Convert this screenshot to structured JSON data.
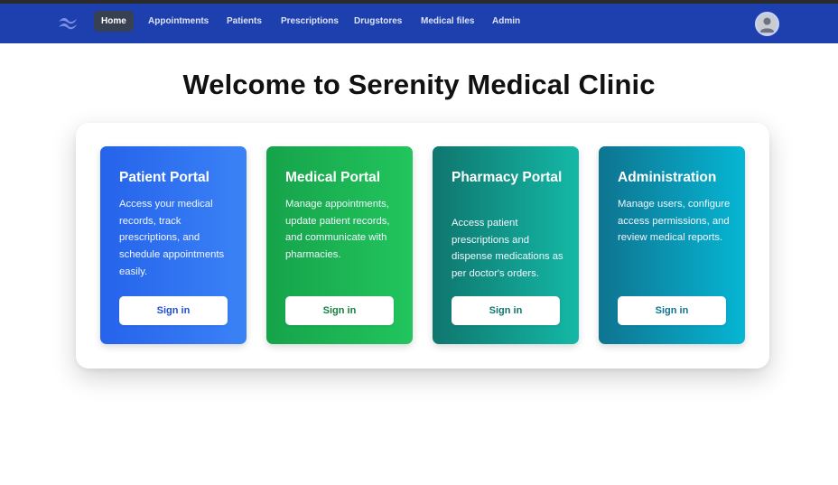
{
  "nav": {
    "items": [
      {
        "label": "Home",
        "active": true
      },
      {
        "label": "Appointments"
      },
      {
        "label": "Patients"
      },
      {
        "label": "Prescriptions"
      },
      {
        "label": "Drugstores"
      },
      {
        "label": "Medical files"
      },
      {
        "label": "Admin"
      }
    ],
    "logo_icon": "tailwind-wave-icon",
    "avatar_icon": "user-avatar-icon"
  },
  "page": {
    "title": "Welcome to Serenity Medical Clinic"
  },
  "cards": [
    {
      "title": "Patient Portal",
      "description": "Access your medical records, track prescriptions, and schedule appointments easily.",
      "button": "Sign in",
      "color": "#2563eb"
    },
    {
      "title": "Medical Portal",
      "description": "Manage appointments, update patient records, and communicate with pharmacies.",
      "button": "Sign in",
      "color": "#16a34a"
    },
    {
      "title": "Pharmacy Portal",
      "description": "Access patient prescriptions and dispense medications as per doctor's orders.",
      "button": "Sign in",
      "color": "#0f766e"
    },
    {
      "title": "Administration",
      "description": "Manage users, configure access permissions, and review medical reports.",
      "button": "Sign in",
      "color": "#0e7490"
    }
  ]
}
